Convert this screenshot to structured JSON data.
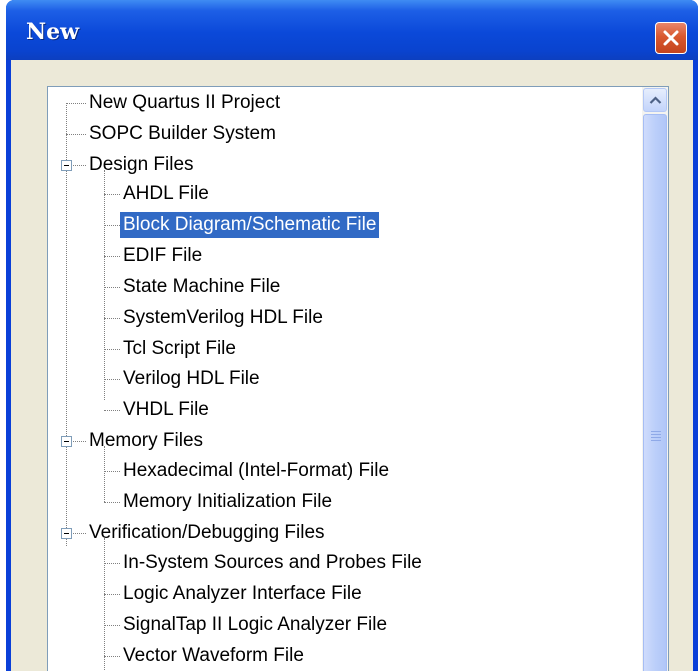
{
  "window": {
    "title": "New"
  },
  "tree": {
    "items": [
      {
        "label": "New Quartus II Project"
      },
      {
        "label": "SOPC Builder System"
      },
      {
        "label": "Design Files"
      },
      {
        "label": "AHDL File"
      },
      {
        "label": "Block Diagram/Schematic File"
      },
      {
        "label": "EDIF File"
      },
      {
        "label": "State Machine File"
      },
      {
        "label": "SystemVerilog HDL File"
      },
      {
        "label": "Tcl Script File"
      },
      {
        "label": "Verilog HDL File"
      },
      {
        "label": "VHDL File"
      },
      {
        "label": "Memory Files"
      },
      {
        "label": "Hexadecimal (Intel-Format) File"
      },
      {
        "label": "Memory Initialization File"
      },
      {
        "label": "Verification/Debugging Files"
      },
      {
        "label": "In-System Sources and Probes File"
      },
      {
        "label": "Logic Analyzer Interface File"
      },
      {
        "label": "SignalTap II Logic Analyzer File"
      },
      {
        "label": "Vector Waveform File"
      }
    ],
    "selected": "Block Diagram/Schematic File"
  },
  "colors": {
    "title_bar": "#0a43cf",
    "selection": "#316ac5",
    "close_button": "#d9582f"
  },
  "icons": [
    "close-icon",
    "collapse-icon",
    "scroll-up-arrow-icon",
    "scroll-grip-icon"
  ]
}
